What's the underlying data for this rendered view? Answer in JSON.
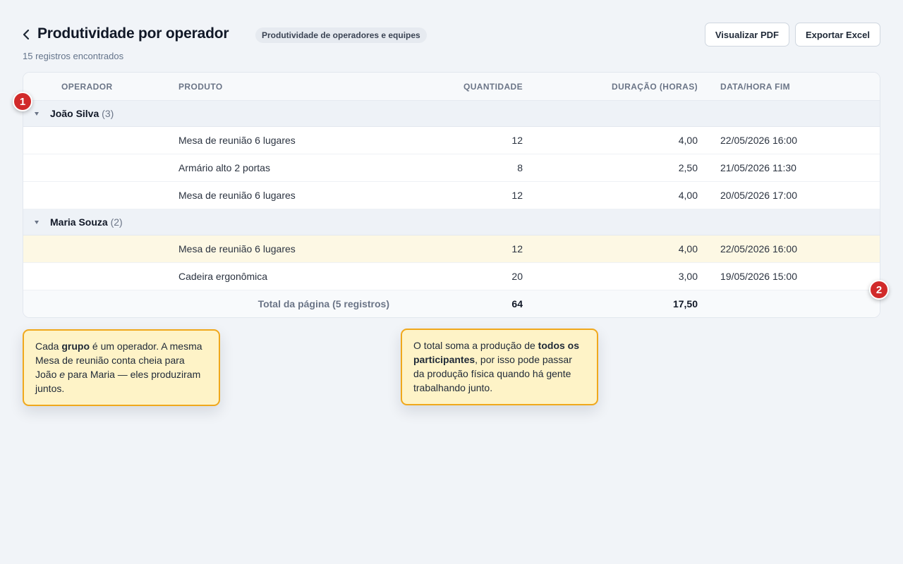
{
  "header": {
    "title": "Produtividade por operador",
    "badge": "Produtividade de operadores e equipes",
    "subtitle": "15 registros encontrados",
    "buttons": {
      "pdf": "Visualizar PDF",
      "excel": "Exportar Excel"
    }
  },
  "table": {
    "columns": [
      "OPERADOR",
      "PRODUTO",
      "QUANTIDADE",
      "DURAÇÃO (HORAS)",
      "DATA/HORA FIM"
    ],
    "groups": [
      {
        "name": "João Silva",
        "count": "(3)",
        "rows": [
          {
            "produto": "Mesa de reunião 6 lugares",
            "quantidade": "12",
            "duracao": "4,00",
            "data": "22/05/2026 16:00"
          },
          {
            "produto": "Armário alto 2 portas",
            "quantidade": "8",
            "duracao": "2,50",
            "data": "21/05/2026 11:30"
          },
          {
            "produto": "Mesa de reunião 6 lugares",
            "quantidade": "12",
            "duracao": "4,00",
            "data": "20/05/2026 17:00"
          }
        ]
      },
      {
        "name": "Maria Souza",
        "count": "(2)",
        "rows": [
          {
            "produto": "Mesa de reunião 6 lugares",
            "quantidade": "12",
            "duracao": "4,00",
            "data": "22/05/2026 16:00"
          },
          {
            "produto": "Cadeira ergonômica",
            "quantidade": "20",
            "duracao": "3,00",
            "data": "19/05/2026 15:00"
          }
        ]
      }
    ],
    "total": {
      "label": "Total da página (5 registros)",
      "quantidade": "64",
      "duracao": "17,50"
    }
  },
  "markers": [
    "1",
    "2"
  ],
  "callouts": {
    "first": {
      "t1": "Cada ",
      "b1": "grupo",
      "t2": " é um operador. A mesma Mesa de reunião conta cheia para João ",
      "i1": "e",
      "t3": " para Maria — eles produziram juntos."
    },
    "second": {
      "t1": "O total soma a produção de ",
      "b1": "todos os participantes",
      "t2": ", por isso pode passar da produção física quando há gente trabalhando junto."
    }
  },
  "colors": {
    "marker": "#d12a2a",
    "callout_bg": "#fef3c7",
    "callout_border": "#f0a81c",
    "highlight_row": "#fdf8e4"
  }
}
